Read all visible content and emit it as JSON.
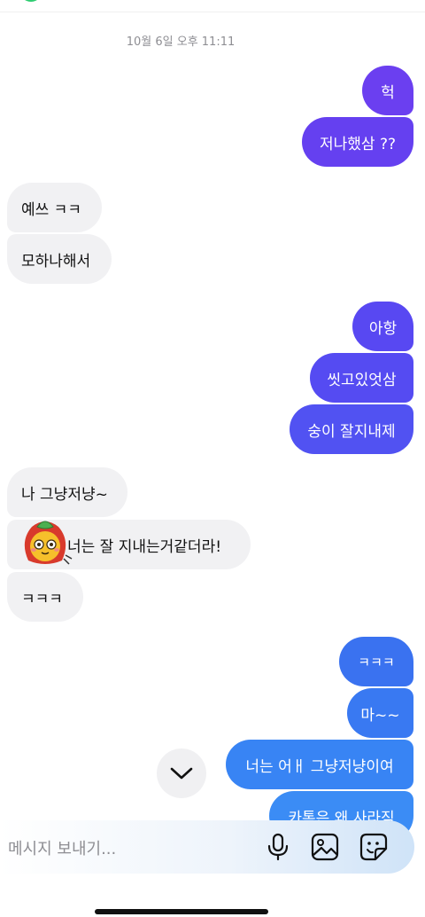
{
  "chat": {
    "timestamp": "10월 6일 오후 11:11",
    "messages": [
      {
        "text": "헉",
        "side": "sent",
        "color": "#6b3ff0"
      },
      {
        "text": "저나했삼 ??",
        "side": "sent",
        "color": "#6b3ff0"
      },
      {
        "text": "예쓰 ㅋㅋ",
        "side": "received"
      },
      {
        "text": "모하나해서",
        "side": "received"
      },
      {
        "text": "아항",
        "side": "sent",
        "color": "#5848f2"
      },
      {
        "text": "씻고있엇삼",
        "side": "sent",
        "color": "#5848f2"
      },
      {
        "text": "숭이 잘지내제",
        "side": "sent",
        "color": "#5152f2"
      },
      {
        "text": "나 그냥저냥~",
        "side": "received"
      },
      {
        "text": "너는 잘 지내는거같더라!",
        "side": "received",
        "has_sticker": true
      },
      {
        "text": "ㅋㅋㅋ",
        "side": "received"
      },
      {
        "text": "ㅋㅋㅋ",
        "side": "sent",
        "color": "#3a72f0"
      },
      {
        "text": "마~~",
        "side": "sent",
        "color": "#3979f2"
      },
      {
        "text": "너는 어ㅐ 그냥저냥이여",
        "side": "sent",
        "color": "#3884f4"
      },
      {
        "text": "카톡은 왜 사라짐",
        "side": "sent",
        "color": "#3b8cf5"
      }
    ]
  },
  "composer": {
    "placeholder": "메시지 보내기...",
    "icons": [
      "microphone-icon",
      "image-icon",
      "sticker-icon"
    ]
  },
  "scroll_button": {
    "icon": "chevron-down-icon"
  },
  "colors": {
    "received_bubble": "#f1f1f3",
    "sent_gradient_top": "#6b3ff0",
    "sent_gradient_bottom": "#3b8cf5"
  }
}
